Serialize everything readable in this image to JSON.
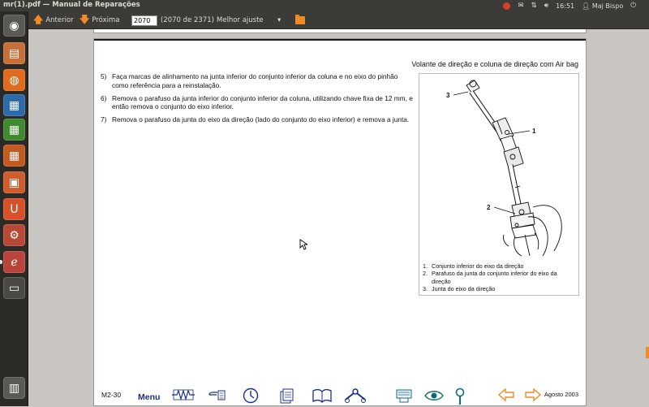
{
  "window": {
    "title": "mr(1).pdf — Manual de Reparações"
  },
  "panel": {
    "time": "16:51",
    "user": "Maj Bispo"
  },
  "launcher": {
    "items": [
      {
        "name": "dash-home",
        "glyph": "◉",
        "color": "#5a5955"
      },
      {
        "name": "files",
        "glyph": "▤",
        "color": "#c8703a"
      },
      {
        "name": "firefox",
        "glyph": "◍",
        "color": "#e06a1d"
      },
      {
        "name": "writer",
        "glyph": "▦",
        "color": "#2c6aa8"
      },
      {
        "name": "calc",
        "glyph": "▦",
        "color": "#3f8a2e"
      },
      {
        "name": "impress",
        "glyph": "▦",
        "color": "#c45a22"
      },
      {
        "name": "software-center",
        "glyph": "▣",
        "color": "#cf5c2b"
      },
      {
        "name": "ubuntu-one",
        "glyph": "U",
        "color": "#d6502a"
      },
      {
        "name": "system-settings",
        "glyph": "⚙",
        "color": "#b84a35"
      },
      {
        "name": "document-viewer",
        "glyph": "ℯ",
        "color": "#b9453a"
      },
      {
        "name": "workspace-switcher",
        "glyph": "▭",
        "color": "#4a4945"
      },
      {
        "name": "trash",
        "glyph": "▥",
        "color": "#5a5955"
      }
    ]
  },
  "toolbar": {
    "prev_label": "Anterior",
    "next_label": "Próxima",
    "page_value": "2070",
    "page_count": "(2070 de 2371)",
    "zoom_label": "Melhor ajuste",
    "zoom_arrow": "▾"
  },
  "page": {
    "section_title": "Volante de direção e coluna de direção com Air bag",
    "steps": [
      {
        "num": "5)",
        "text": "Faça marcas de alinhamento na junta inferior do conjunto inferior da coluna e no eixo do pinhão como referência para a reinstalação."
      },
      {
        "num": "6)",
        "text": "Remova o parafuso da junta inferior do conjunto inferior da coluna, utilizando chave fixa de 12 mm, e então remova o conjunto do eixo inferior."
      },
      {
        "num": "7)",
        "text": "Remova o parafuso da junta do eixo da direção (lado do conjunto do eixo inferior) e remova a junta."
      }
    ],
    "figure": {
      "callouts": [
        "3",
        "1",
        "2"
      ],
      "legend": [
        {
          "num": "1.",
          "text": "Conjunto inferior do eixo da direção"
        },
        {
          "num": "2.",
          "text": "Parafuso da junta do conjunto inferior do eixo da direção"
        },
        {
          "num": "3.",
          "text": "Junta do eixo da direção"
        }
      ]
    },
    "footer": {
      "page_number": "M2-30",
      "menu_label": "Menu",
      "date": "Agosto 2003"
    }
  },
  "colors": {
    "accent": "#f08a24",
    "link_blue": "#1a2f8a",
    "panel": "#3c3b37"
  }
}
